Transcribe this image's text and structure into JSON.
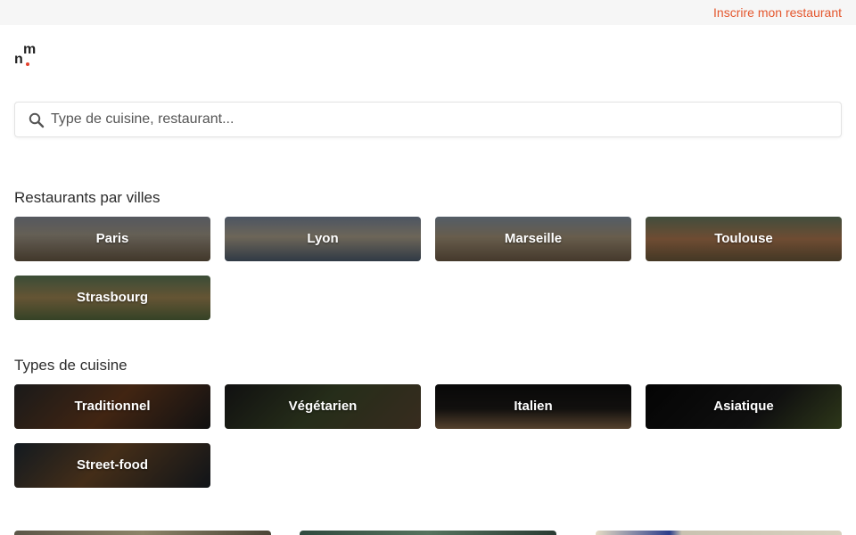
{
  "header": {
    "register_link": "Inscrire mon restaurant"
  },
  "logo": {
    "letter_top": "m",
    "letter_bottom": "n",
    "dot_color": "#e4412e"
  },
  "search": {
    "placeholder": "Type de cuisine, restaurant...",
    "value": "",
    "icon": "search-icon"
  },
  "cities": {
    "title": "Restaurants par villes",
    "items": [
      {
        "label": "Paris"
      },
      {
        "label": "Lyon"
      },
      {
        "label": "Marseille"
      },
      {
        "label": "Toulouse"
      },
      {
        "label": "Strasbourg"
      }
    ]
  },
  "cuisines": {
    "title": "Types de cuisine",
    "items": [
      {
        "label": "Traditionnel"
      },
      {
        "label": "Végétarien"
      },
      {
        "label": "Italien"
      },
      {
        "label": "Asiatique"
      },
      {
        "label": "Street-food"
      }
    ]
  },
  "colors": {
    "accent": "#e4572e",
    "topbar_bg": "#f6f6f6"
  }
}
